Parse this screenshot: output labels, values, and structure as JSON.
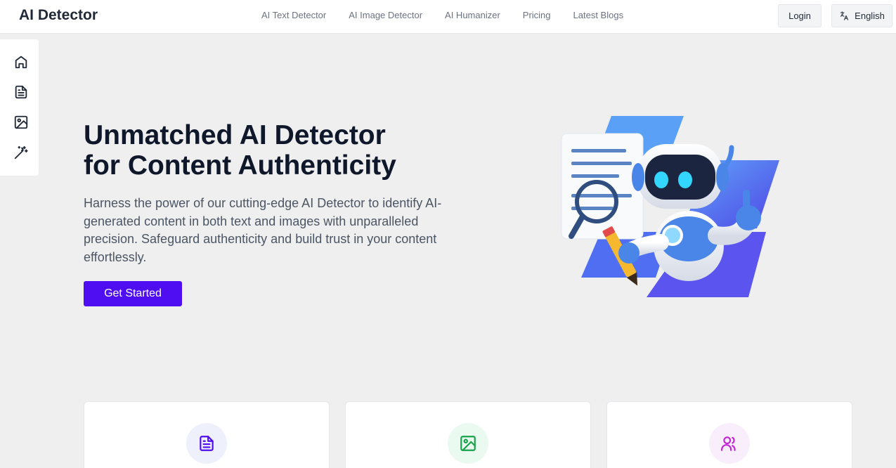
{
  "header": {
    "brand": "AI Detector",
    "nav": [
      "AI Text Detector",
      "AI Image Detector",
      "AI Humanizer",
      "Pricing",
      "Latest Blogs"
    ],
    "login_label": "Login",
    "language_label": "English"
  },
  "sidebar": {
    "icons": [
      "home-icon",
      "document-icon",
      "image-icon",
      "magic-wand-icon"
    ]
  },
  "hero": {
    "title_line1": "Unmatched AI Detector",
    "title_line2": "for Content Authenticity",
    "description": "Harness the power of our cutting-edge AI Detector to identify AI-generated content in both text and images with unparalleled precision. Safeguard authenticity and build trust in your content effortlessly.",
    "cta_label": "Get Started"
  },
  "cards": [
    {
      "icon": "document-icon",
      "color": "#4f0df2",
      "bg": "#eef0fb"
    },
    {
      "icon": "image-icon",
      "color": "#16a34a",
      "bg": "#eafaf0"
    },
    {
      "icon": "users-icon",
      "color": "#c026d3",
      "bg": "#f9eefb"
    }
  ],
  "colors": {
    "accent": "#4f0df2",
    "background": "#efefef"
  }
}
